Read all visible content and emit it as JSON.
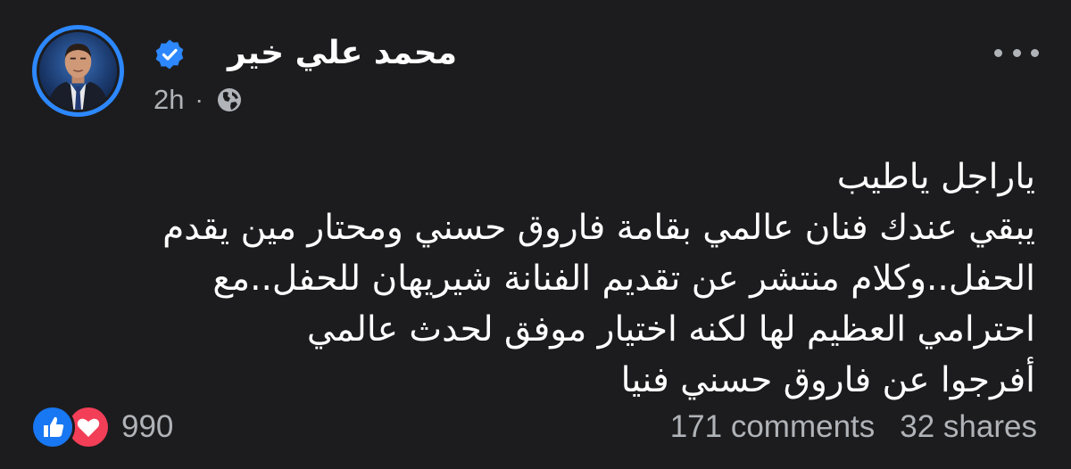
{
  "post": {
    "author": {
      "name": "محمد علي خير",
      "verified": true,
      "badge_color": "#2d88ff"
    },
    "timestamp": "2h",
    "separator": "·",
    "audience_icon": "globe-icon",
    "more_icon": "more-horizontal-icon",
    "text_lines": [
      "ياراجل ياطيب",
      "يبقي عندك فنان عالمي بقامة فاروق حسني ومحتار مين يقدم",
      "الحفل..وكلام منتشر عن تقديم الفنانة شيريهان للحفل..مع",
      "احترامي العظيم لها لكنه اختيار موفق لحدث عالمي",
      "أفرجوا عن فاروق حسني فنيا"
    ]
  },
  "footer": {
    "reaction_icons": [
      "like-icon",
      "love-icon"
    ],
    "reaction_count": "990",
    "comments": "171 comments",
    "shares": "32 shares"
  },
  "colors": {
    "background": "#1c1c1e",
    "text": "#ffffff",
    "secondary_text": "#b0b3b8",
    "accent": "#2d88ff",
    "like": "#1877f2",
    "love": "#f33e58"
  }
}
